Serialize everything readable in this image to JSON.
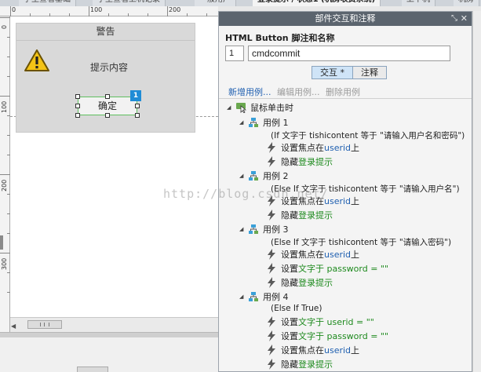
{
  "tabs": [
    {
      "label": "学生查看基础"
    },
    {
      "label": "学生查看上机记录"
    },
    {
      "label": "一般用户"
    },
    {
      "label": "登录提示 / 状态1 (机房收费系统)"
    },
    {
      "label": "上下机"
    },
    {
      "label": "机房"
    }
  ],
  "ruler": {
    "h_labels": [
      "0",
      "100",
      "200"
    ],
    "v_labels": [
      "0",
      "100",
      "200",
      "300"
    ]
  },
  "dialog": {
    "title": "警告",
    "message": "提示内容",
    "ok_label": "确定",
    "badge": "1"
  },
  "panel": {
    "header": "部件交互和注释",
    "prop_title": "HTML Button 脚注和名称",
    "footnote_number": "1",
    "name_value": "cmdcommit",
    "seg_interaction": "交互 *",
    "seg_notes": "注释",
    "action_new": "新增用例...",
    "action_edit": "编辑用例...",
    "action_delete": "删除用例",
    "event_label": "鼠标单击时",
    "cases": [
      {
        "label": "用例 1",
        "condition": "(If 文字于 tishicontent 等于 \"请输入用户名和密码\")",
        "actions": [
          {
            "verb": "设置焦点在 ",
            "target": "userid",
            "tail": " 上",
            "target_color": "blue"
          },
          {
            "verb": "隐藏 ",
            "target": "登录提示",
            "tail": "",
            "target_color": "green"
          }
        ]
      },
      {
        "label": "用例 2",
        "condition": "(Else If 文字于 tishicontent 等于 \"请输入用户名\")",
        "actions": [
          {
            "verb": "设置焦点在 ",
            "target": "userid",
            "tail": " 上",
            "target_color": "blue"
          },
          {
            "verb": "隐藏 ",
            "target": "登录提示",
            "tail": "",
            "target_color": "green"
          }
        ]
      },
      {
        "label": "用例 3",
        "condition": "(Else If 文字于 tishicontent 等于 \"请输入密码\")",
        "actions": [
          {
            "verb": "设置焦点在 ",
            "target": "userid",
            "tail": " 上",
            "target_color": "blue"
          },
          {
            "verb": "设置 ",
            "target": "文字于 password = \"\"",
            "tail": "",
            "target_color": "green"
          },
          {
            "verb": "隐藏 ",
            "target": "登录提示",
            "tail": "",
            "target_color": "green"
          }
        ]
      },
      {
        "label": "用例 4",
        "condition": "(Else If True)",
        "actions": [
          {
            "verb": "设置 ",
            "target": "文字于 userid = \"\"",
            "tail": "",
            "target_color": "green"
          },
          {
            "verb": "设置 ",
            "target": "文字于 password = \"\"",
            "tail": "",
            "target_color": "green"
          },
          {
            "verb": "设置焦点在 ",
            "target": "userid",
            "tail": " 上",
            "target_color": "blue"
          },
          {
            "verb": "隐藏 ",
            "target": "登录提示",
            "tail": "",
            "target_color": "green"
          }
        ]
      }
    ]
  },
  "watermark": "http://blog.csdn.net/",
  "colors": {
    "accent_blue": "#1f8cd6",
    "link_blue": "#1f5fb0",
    "green_text": "#1e8a1e",
    "panel_header": "#5b646e",
    "warning_yellow": "#f3c316"
  }
}
